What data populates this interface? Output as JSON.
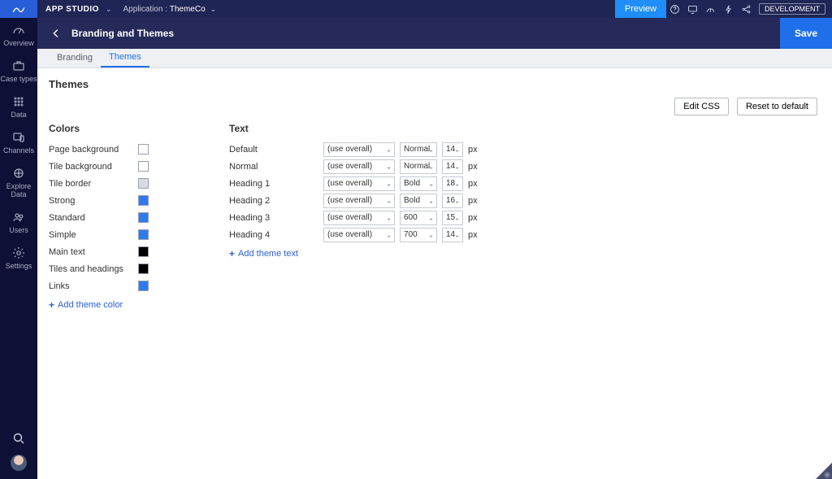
{
  "brand": {
    "title": "APP STUDIO",
    "app_label": "Application :",
    "app_name": "ThemeCo"
  },
  "topbar": {
    "preview": "Preview",
    "dev": "DEVELOPMENT"
  },
  "sidebar": {
    "items": [
      {
        "label": "Overview"
      },
      {
        "label": "Case types"
      },
      {
        "label": "Data"
      },
      {
        "label": "Channels"
      },
      {
        "label": "Explore Data"
      },
      {
        "label": "Users"
      },
      {
        "label": "Settings"
      }
    ]
  },
  "header": {
    "title": "Branding and Themes",
    "save": "Save"
  },
  "tabs": [
    {
      "label": "Branding",
      "active": false
    },
    {
      "label": "Themes",
      "active": true
    }
  ],
  "page": {
    "title": "Themes"
  },
  "buttons": {
    "edit_css": "Edit CSS",
    "reset": "Reset to default"
  },
  "colors": {
    "heading": "Colors",
    "rows": [
      {
        "label": "Page background",
        "color": "#ffffff"
      },
      {
        "label": "Tile background",
        "color": "#ffffff"
      },
      {
        "label": "Tile border",
        "color": "#d8dbe2"
      },
      {
        "label": "Strong",
        "color": "#2d7bf0"
      },
      {
        "label": "Standard",
        "color": "#2d7bf0"
      },
      {
        "label": "Simple",
        "color": "#2d7bf0"
      },
      {
        "label": "Main text",
        "color": "#000000"
      },
      {
        "label": "Tiles and headings",
        "color": "#000000"
      },
      {
        "label": "Links",
        "color": "#2d7bf0"
      }
    ],
    "add": "Add theme color"
  },
  "text": {
    "heading": "Text",
    "rows": [
      {
        "label": "Default",
        "font": "(use overall)",
        "weight": "Normal",
        "size": "14"
      },
      {
        "label": "Normal",
        "font": "(use overall)",
        "weight": "Normal",
        "size": "14"
      },
      {
        "label": "Heading 1",
        "font": "(use overall)",
        "weight": "Bold",
        "size": "18"
      },
      {
        "label": "Heading 2",
        "font": "(use overall)",
        "weight": "Bold",
        "size": "16"
      },
      {
        "label": "Heading 3",
        "font": "(use overall)",
        "weight": "600",
        "size": "15"
      },
      {
        "label": "Heading 4",
        "font": "(use overall)",
        "weight": "700",
        "size": "14"
      }
    ],
    "unit": "px",
    "add": "Add theme text"
  }
}
